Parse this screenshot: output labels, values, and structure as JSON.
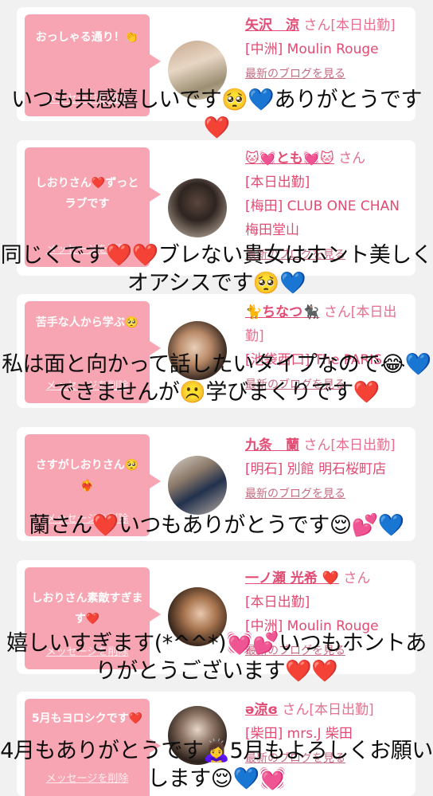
{
  "cards": [
    {
      "message": "おっしゃる通り！👏",
      "delete_label": "メッセージを削除",
      "name": "矢沢　涼",
      "san": "さん[本日出勤]",
      "shop": "[中洲] Moulin Rouge",
      "blog": "最新のブログを見る",
      "caption": "いつも共感嬉しいです🥺💙ありがとうです❤️"
    },
    {
      "message": "しおりさん❤️ずっとラブです",
      "delete_label": "メッセージを削除",
      "name": "🐱💓とも💓🐱",
      "san": "さん",
      "status": "[本日出勤]",
      "shop": "[梅田] CLUB ONE CHAN 梅田堂山",
      "blog": "最新のブログを見る",
      "caption": "同じくです❤️❤️ブレない貴女はホント美しくオアシスです🥺💙"
    },
    {
      "message": "苦手な人から学ぶ🥺",
      "delete_label": "メッセージを削除",
      "name": "🐈ちなつ🐈‍⬛",
      "san": "さん[本日出勤]",
      "shop": "[池袋西口] The PARIS",
      "blog": "最新のブログを見る",
      "caption": "私は面と向かって話したいタイプなので😂💙できませんが☹️学びまくりです❤️"
    },
    {
      "message": "さすがしおりさん🥺❤️‍🔥",
      "delete_label": "メッセージを削除",
      "name": "九条　蘭",
      "san": "さん[本日出勤]",
      "shop": "[明石] 別館 明石桜町店",
      "blog": "最新のブログを見る",
      "caption": "蘭さん❤️いつもありがとうです😌💕💙"
    },
    {
      "message": "しおりさん素敵すぎます❤️",
      "delete_label": "メッセージを削除",
      "name": "一ノ瀬 光希 ❤️",
      "san": "さん",
      "status": "[本日出勤]",
      "shop": "[中洲] Moulin Rouge",
      "blog": "最新のブログを見る",
      "caption": "嬉しいすぎます(*^^*)💓💕いつもホントありがとうございます❤️❤️"
    },
    {
      "message": "5月もヨロシクです❤️",
      "delete_label": "メッセージを削除",
      "name": "ə涼ɞ",
      "san": "さん[本日出勤]",
      "shop": "[柴田] mrs.J 柴田",
      "blog": "最新のブログを見る",
      "caption": "4月もありがとうです🙇‍♀️5月もよろしくお願いします😌💙💓"
    }
  ]
}
